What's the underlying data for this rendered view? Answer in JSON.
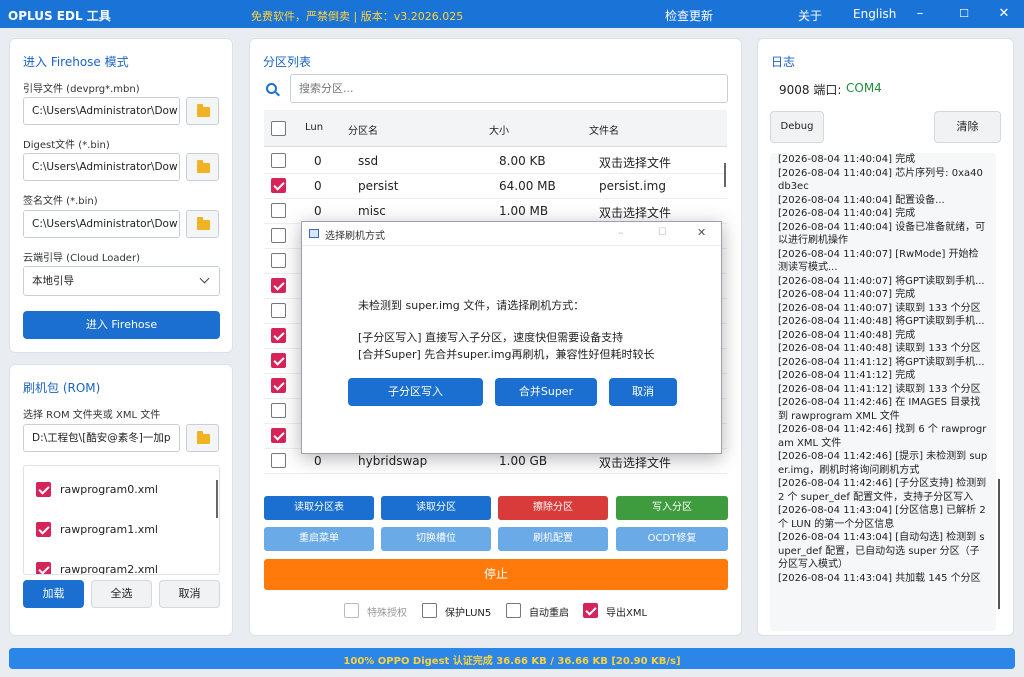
{
  "title": {
    "app": "OPLUS EDL 工具",
    "slogan": "免费软件，严禁倒卖 | 版本：v3.2026.025",
    "check_update": "检查更新",
    "about": "关于",
    "language": "English",
    "min": "–",
    "max": "☐",
    "close": "✕"
  },
  "firehose": {
    "title": "进入 Firehose 模式",
    "programmer_label": "引导文件 (devprg*.mbn)",
    "programmer_value": "C:\\Users\\Administrator\\Dow",
    "digest_label": "Digest文件 (*.bin)",
    "digest_value": "C:\\Users\\Administrator\\Dow",
    "sign_label": "签名文件 (*.bin)",
    "sign_value": "C:\\Users\\Administrator\\Dow",
    "cloud_label": "云端引导 (Cloud Loader)",
    "cloud_value": "本地引导",
    "enter_button": "进入 Firehose"
  },
  "rom": {
    "title": "刷机包 (ROM)",
    "select_label": "选择 ROM 文件夹或 XML 文件",
    "path_value": "D:\\工程包\\[酷安@素冬]一加p",
    "files": [
      {
        "name": "rawprogram0.xml",
        "checked": true
      },
      {
        "name": "rawprogram1.xml",
        "checked": true
      },
      {
        "name": "rawprogram2.xml",
        "checked": true
      }
    ],
    "load": "加载",
    "select_all": "全选",
    "cancel": "取消"
  },
  "partitions": {
    "title": "分区列表",
    "search_placeholder": "搜索分区...",
    "headers": {
      "lun": "Lun",
      "name": "分区名",
      "size": "大小",
      "file": "文件名"
    },
    "rows": [
      {
        "checked": false,
        "lun": "0",
        "name": "ssd",
        "size": "8.00 KB",
        "file": "双击选择文件"
      },
      {
        "checked": true,
        "lun": "0",
        "name": "persist",
        "size": "64.00 MB",
        "file": "persist.img"
      },
      {
        "checked": false,
        "lun": "0",
        "name": "misc",
        "size": "1.00 MB",
        "file": "双击选择文件"
      },
      {
        "checked": false,
        "lun": "",
        "name": "",
        "size": "",
        "file": ""
      },
      {
        "checked": false,
        "lun": "",
        "name": "",
        "size": "",
        "file": ""
      },
      {
        "checked": true,
        "lun": "",
        "name": "",
        "size": "",
        "file": ""
      },
      {
        "checked": false,
        "lun": "",
        "name": "",
        "size": "",
        "file": ""
      },
      {
        "checked": true,
        "lun": "",
        "name": "",
        "size": "",
        "file": ""
      },
      {
        "checked": true,
        "lun": "",
        "name": "",
        "size": "",
        "file": ""
      },
      {
        "checked": true,
        "lun": "",
        "name": "",
        "size": "",
        "file": ""
      },
      {
        "checked": false,
        "lun": "",
        "name": "",
        "size": "",
        "file": ""
      },
      {
        "checked": true,
        "lun": "",
        "name": "",
        "size": "",
        "file": ""
      },
      {
        "checked": false,
        "lun": "0",
        "name": "hybridswap",
        "size": "1.00 GB",
        "file": "双击选择文件"
      }
    ]
  },
  "actions": {
    "read_table": "读取分区表",
    "read_part": "读取分区",
    "erase_part": "擦除分区",
    "write_part": "写入分区",
    "reboot_menu": "重启菜单",
    "switch_slot": "切换槽位",
    "flash_config": "刷机配置",
    "ocdt_fix": "OCDT修复",
    "stop": "停止"
  },
  "options": [
    {
      "label": "特殊授权",
      "checked": false,
      "disabled": true
    },
    {
      "label": "保护LUN5",
      "checked": false
    },
    {
      "label": "自动重启",
      "checked": false
    },
    {
      "label": "导出XML",
      "checked": true
    }
  ],
  "log": {
    "title": "日志",
    "port_label": "9008 端口:",
    "port_value": "COM4",
    "debug": "Debug",
    "clear": "清除",
    "lines": [
      "[2026-08-04 11:40:04] 完成",
      "[2026-08-04 11:40:04] 芯片序列号: 0xa40db3ec",
      "[2026-08-04 11:40:04] 配置设备...",
      "[2026-08-04 11:40:04] 完成",
      "[2026-08-04 11:40:04] 设备已准备就绪，可以进行刷机操作",
      "[2026-08-04 11:40:07] [RwMode] 开始检测读写模式...",
      "[2026-08-04 11:40:07] 将GPT读取到手机...",
      "[2026-08-04 11:40:07] 完成",
      "[2026-08-04 11:40:07] 读取到 133 个分区",
      "[2026-08-04 11:40:48] 将GPT读取到手机...",
      "[2026-08-04 11:40:48] 完成",
      "[2026-08-04 11:40:48] 读取到 133 个分区",
      "[2026-08-04 11:41:12] 将GPT读取到手机...",
      "[2026-08-04 11:41:12] 完成",
      "[2026-08-04 11:41:12] 读取到 133 个分区",
      "[2026-08-04 11:42:46] 在 IMAGES 目录找到 rawprogram XML 文件",
      "[2026-08-04 11:42:46] 找到 6 个 rawprogram XML 文件",
      "[2026-08-04 11:42:46] [提示] 未检测到 super.img，刷机时将询问刷机方式",
      "[2026-08-04 11:42:46] [子分区支持] 检测到 2 个 super_def 配置文件，支持子分区写入",
      "[2026-08-04 11:43:04] [分区信息] 已解析 2 个 LUN 的第一个分区信息",
      "[2026-08-04 11:43:04] [自动勾选] 检测到 super_def 配置，已自动勾选 super 分区（子分区写入模式）",
      "[2026-08-04 11:43:04] 共加载 145 个分区"
    ]
  },
  "dialog": {
    "title": "选择刷机方式",
    "line1": "未检测到 super.img 文件，请选择刷机方式：",
    "line2": "[子分区写入] 直接写入子分区，速度快但需要设备支持",
    "line3": "[合并Super] 先合并super.img再刷机，兼容性好但耗时较长",
    "btn_sub": "子分区写入",
    "btn_merge": "合并Super",
    "btn_cancel": "取消"
  },
  "status": {
    "text": "100% OPPO Digest 认证完成  36.66 KB / 36.66 KB  [20.90 KB/s]",
    "progress": 1.0
  },
  "colors": {
    "accent": "#1a6fd0",
    "checked": "#d6245b",
    "erase": "#d93a3a",
    "write": "#3e9b3e",
    "stop": "#ff7a0a",
    "light": "#6aaae6"
  }
}
